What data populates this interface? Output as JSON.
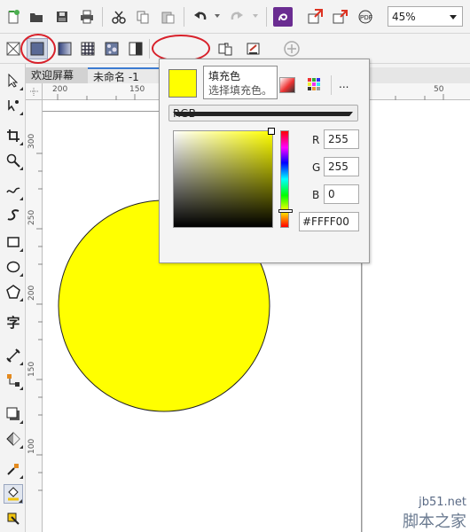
{
  "colors": {
    "fill": "#FFFF00",
    "accent_ring": "#d8202a",
    "corel_purple": "#6a2c91"
  },
  "toolbar": {
    "zoom_value": "45%",
    "icons": [
      "new-icon",
      "open-icon",
      "save-icon",
      "print-icon",
      "cut-icon",
      "copy-icon",
      "paste-icon",
      "undo-icon",
      "redo-icon",
      "corel-app-icon",
      "import-icon",
      "export-icon",
      "publish-pdf-icon"
    ]
  },
  "property_bar": {
    "fill_swatch_color": "#FFFF00"
  },
  "document_tabs": [
    {
      "label": "欢迎屏幕"
    },
    {
      "label": "未命名 -1"
    }
  ],
  "rulers": {
    "top": [
      {
        "label": "200"
      },
      {
        "label": "150"
      },
      {
        "label": "50"
      }
    ],
    "left": [
      {
        "label": "300"
      },
      {
        "label": "250"
      },
      {
        "label": "200"
      },
      {
        "label": "150"
      },
      {
        "label": "100"
      }
    ]
  },
  "fill_popup": {
    "tooltip_title": "填充色",
    "tooltip_desc": "选择填充色。",
    "more_label": "...",
    "color_model": "RGB",
    "channels": [
      {
        "label": "R",
        "value": "255"
      },
      {
        "label": "G",
        "value": "255"
      },
      {
        "label": "B",
        "value": "0"
      }
    ],
    "hex": "#FFFF00"
  },
  "watermark": {
    "site": "jb51.net",
    "name": "脚本之家"
  }
}
